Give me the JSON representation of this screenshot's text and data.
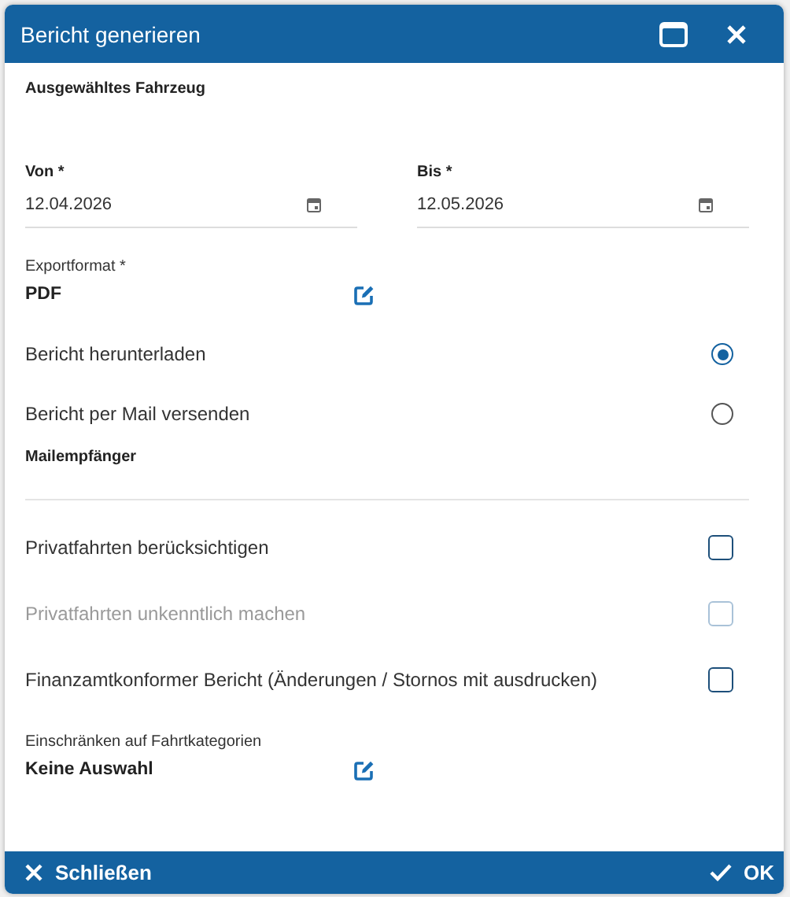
{
  "window": {
    "title": "Bericht generieren"
  },
  "vehicle": {
    "label": "Ausgewähltes Fahrzeug"
  },
  "dates": [
    {
      "label": "Von *",
      "value": "12.04.2026"
    },
    {
      "label": "Bis *",
      "value": "12.05.2026"
    }
  ],
  "export_format": {
    "label": "Exportformat *",
    "value": "PDF"
  },
  "delivery": [
    {
      "label": "Bericht herunterladen",
      "selected": true
    },
    {
      "label": "Bericht per Mail versenden",
      "selected": false
    }
  ],
  "mail_recipients": {
    "label": "Mailempfänger"
  },
  "options": [
    {
      "label": "Privatfahrten berücksichtigen",
      "checked": false,
      "disabled": false
    },
    {
      "label": "Privatfahrten unkenntlich machen",
      "checked": false,
      "disabled": true
    },
    {
      "label": "Finanzamtkonformer Bericht (Änderungen / Stornos mit ausdrucken)",
      "checked": false,
      "disabled": false
    }
  ],
  "categories": {
    "label": "Einschränken auf Fahrtkategorien",
    "value": "Keine Auswahl"
  },
  "footer": {
    "close": "Schließen",
    "ok": "OK"
  }
}
